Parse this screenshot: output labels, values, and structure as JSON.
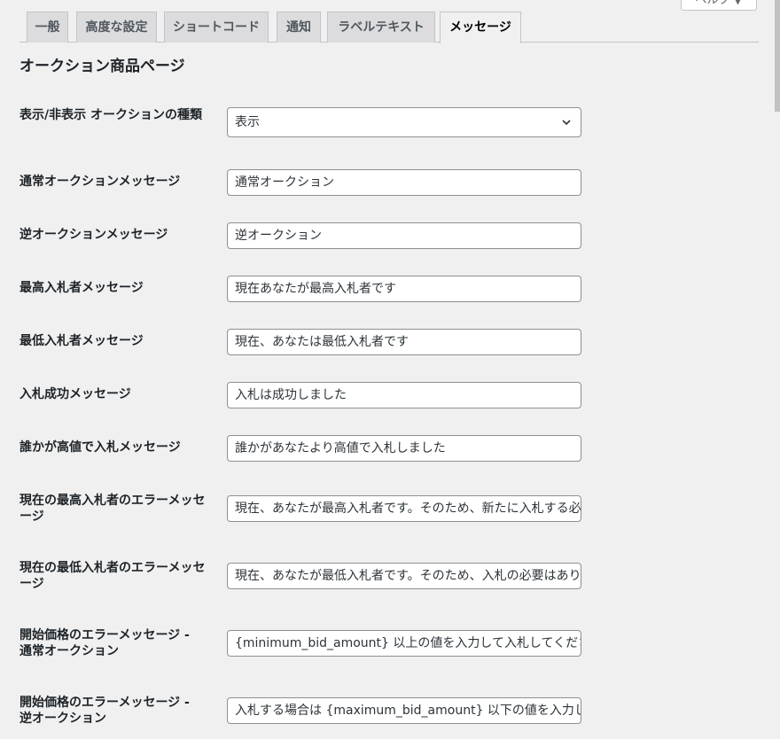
{
  "help_tab": {
    "label": "ヘルプ ▼"
  },
  "tabs": [
    {
      "label": "一般",
      "active": false
    },
    {
      "label": "高度な設定",
      "active": false
    },
    {
      "label": "ショートコード",
      "active": false
    },
    {
      "label": "通知",
      "active": false
    },
    {
      "label": "ラベルテキスト",
      "active": false
    },
    {
      "label": "メッセージ",
      "active": true
    }
  ],
  "section": {
    "title": "オークション商品ページ"
  },
  "fields": [
    {
      "label": "表示/非表示 オークションの種類",
      "type": "select",
      "value": "表示"
    },
    {
      "label": "通常オークションメッセージ",
      "type": "text",
      "value": "通常オークション"
    },
    {
      "label": "逆オークションメッセージ",
      "type": "text",
      "value": "逆オークション"
    },
    {
      "label": "最高入札者メッセージ",
      "type": "text",
      "value": "現在あなたが最高入札者です"
    },
    {
      "label": "最低入札者メッセージ",
      "type": "text",
      "value": "現在、あなたは最低入札者です"
    },
    {
      "label": "入札成功メッセージ",
      "type": "text",
      "value": "入札は成功しました"
    },
    {
      "label": "誰かが高値で入札メッセージ",
      "type": "text",
      "value": "誰かがあなたより高値で入札しました"
    },
    {
      "label": "現在の最高入札者のエラーメッセージ",
      "type": "text",
      "value": "現在、あなたが最高入札者です。そのため、新たに入札する必要はありません。"
    },
    {
      "label": "現在の最低入札者のエラーメッセージ",
      "type": "text",
      "value": "現在、あなたが最低入札者です。そのため、入札の必要はありません。"
    },
    {
      "label": "開始価格のエラーメッセージ - 通常オークション",
      "type": "text",
      "value": "{minimum_bid_amount} 以上の値を入力して入札してください。"
    },
    {
      "label": "開始価格のエラーメッセージ - 逆オークション",
      "type": "text",
      "value": "入札する場合は {maximum_bid_amount} 以下の値を入力してください。"
    }
  ]
}
